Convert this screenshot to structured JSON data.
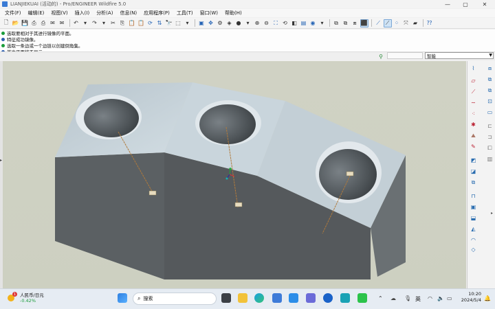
{
  "window": {
    "title": "LIANJIEKUAI (活动的) - Pro/ENGINEER Wildfire 5.0",
    "minimize": "—",
    "maximize": "▢",
    "close": "✕"
  },
  "menu": [
    "文件(F)",
    "编辑(E)",
    "视图(V)",
    "插入(I)",
    "分析(A)",
    "信息(N)",
    "应用程序(P)",
    "工具(T)",
    "窗口(W)",
    "帮助(H)"
  ],
  "messages": [
    {
      "text": "选取要相对于其进行镜像的平面。",
      "color": "#1a9c3a"
    },
    {
      "text": "特征成功镜像。",
      "color": "#2d5fb0"
    },
    {
      "text": "选取一条边或一个边链以创建倒角集。",
      "color": "#1a9c3a"
    },
    {
      "text": "基准平面将不显示。",
      "color": "#2d5fb0"
    }
  ],
  "filter": {
    "value": "智能"
  },
  "model": {
    "body_color": "#5a5f62",
    "top_color": "#c7d3da",
    "axis_tags": [
      "A_1",
      "A_2",
      "A_3"
    ]
  },
  "taskbar": {
    "weather_title": "人民币/日元",
    "weather_value": "-0.42%",
    "search_placeholder": "搜索",
    "ime": "英",
    "time": "10:20",
    "date": "2024/5/4",
    "notif_count": "1"
  }
}
